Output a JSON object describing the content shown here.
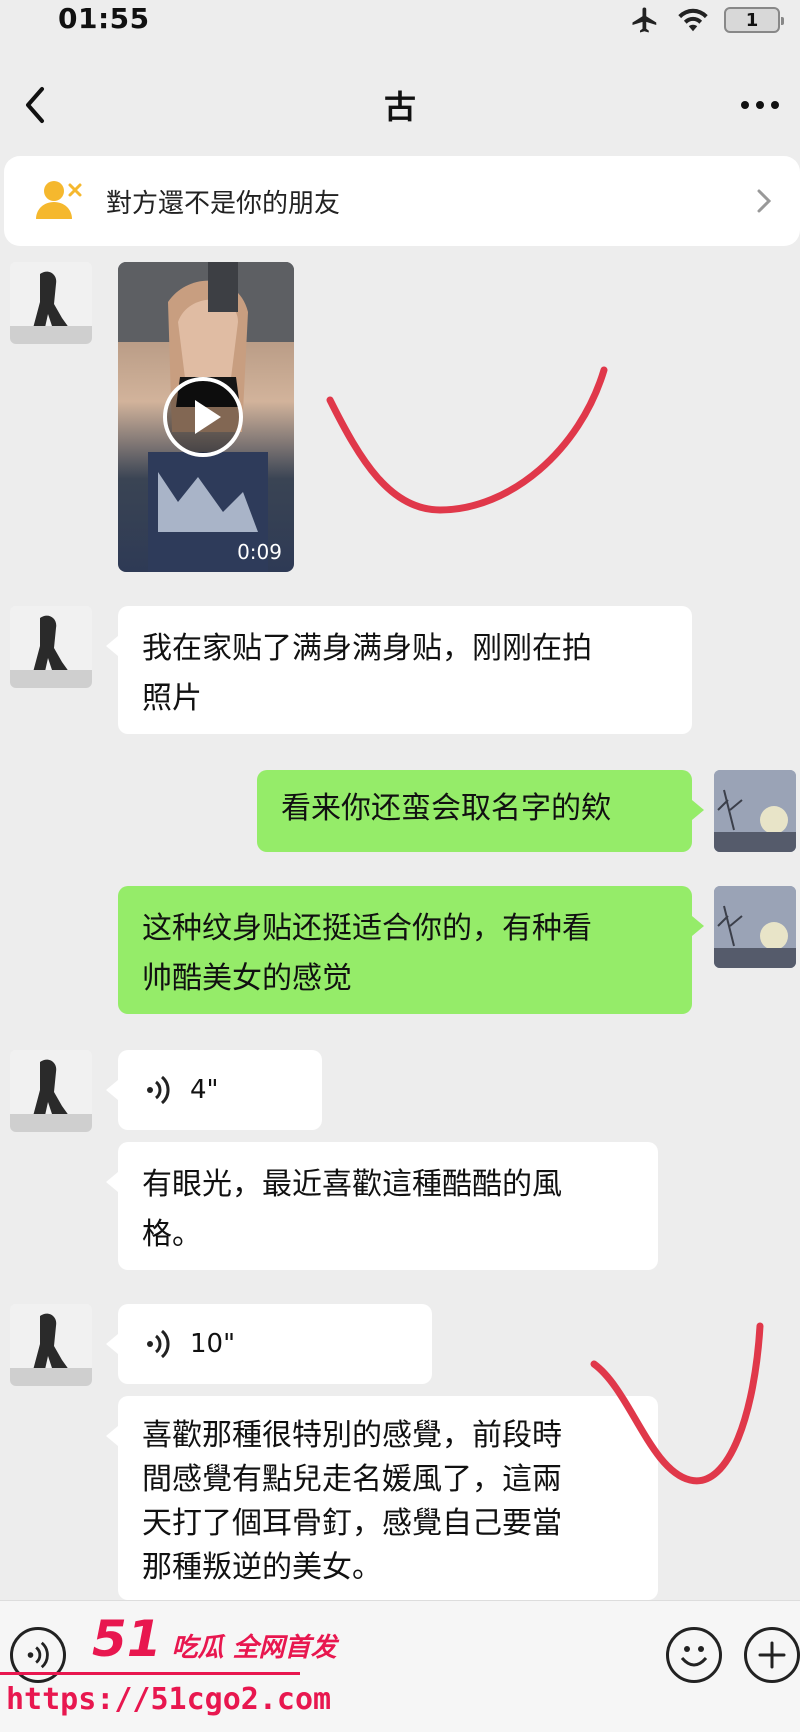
{
  "status_bar": {
    "time": "01:55",
    "battery": "1",
    "icons": [
      "airplane-icon",
      "wifi-icon",
      "battery-icon"
    ]
  },
  "nav": {
    "title": "古",
    "back_icon": "chevron-left-icon",
    "more_icon": "more-dots-icon"
  },
  "banner": {
    "text": "對方還不是你的朋友",
    "icon": "person-x-icon",
    "arrow": "chevron-right-icon",
    "icon_color": "#f5b82e"
  },
  "messages": [
    {
      "sender": "other",
      "type": "video",
      "duration": "0:09"
    },
    {
      "sender": "other",
      "type": "text",
      "text": "我在家贴了满身满身贴，刚刚在拍\n照片"
    },
    {
      "sender": "self",
      "type": "text",
      "text": "看来你还蛮会取名字的欸"
    },
    {
      "sender": "self",
      "type": "text",
      "text": "这种纹身贴还挺适合你的，有种看\n帅酷美女的感觉"
    },
    {
      "sender": "other",
      "type": "voice",
      "duration": "4\""
    },
    {
      "sender": "other",
      "type": "text",
      "text": "有眼光，最近喜歡這種酷酷的風\n格。"
    },
    {
      "sender": "other",
      "type": "voice",
      "duration": "10\""
    },
    {
      "sender": "other",
      "type": "text",
      "text": "喜歡那種很特別的感覺，前段時\n間感覺有點兒走名媛風了，這兩\n天打了個耳骨釘，感覺自己要當\n那種叛逆的美女。"
    }
  ],
  "bottom_bar": {
    "voice_icon": "voice-icon",
    "emoji_icon": "emoji-icon",
    "plus_icon": "plus-icon"
  },
  "watermark": {
    "number": "51",
    "tagline": "吃瓜 全网首发",
    "url": "https://51cgo2.com",
    "color": "#e8174f"
  },
  "colors": {
    "background": "#ededed",
    "self_bubble": "#95ec69",
    "other_bubble": "#ffffff",
    "annotation": "#e0384a"
  }
}
